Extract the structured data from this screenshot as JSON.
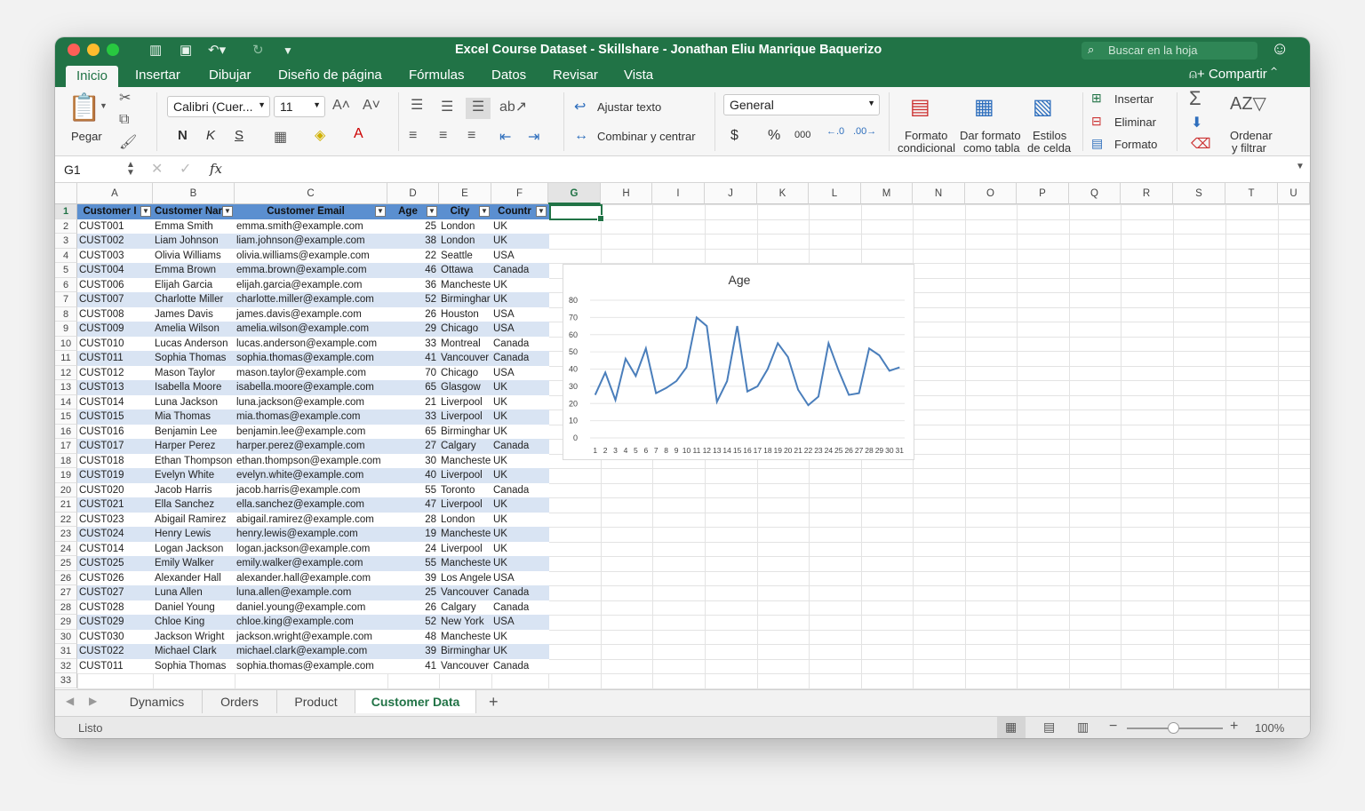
{
  "window": {
    "title": "Excel Course Dataset - Skillshare - Jonathan Eliu Manrique Baquerizo",
    "search_placeholder": "Buscar en la hoja"
  },
  "ribbon_tabs": [
    "Inicio",
    "Insertar",
    "Dibujar",
    "Diseño de página",
    "Fórmulas",
    "Datos",
    "Revisar",
    "Vista"
  ],
  "share_label": "Compartir",
  "ribbon": {
    "paste": "Pegar",
    "font": "Calibri (Cuer...",
    "font_size": "11",
    "bold": "N",
    "italic": "K",
    "underline": "S",
    "wrap_text": "Ajustar texto",
    "merge_center": "Combinar y centrar",
    "number_format": "General",
    "currency": "$",
    "percent": "%",
    "thousands": "000",
    "cond_format_1": "Formato",
    "cond_format_2": "condicional",
    "table_format_1": "Dar formato",
    "table_format_2": "como tabla",
    "cell_styles_1": "Estilos",
    "cell_styles_2": "de celda",
    "insert": "Insertar",
    "delete": "Eliminar",
    "format": "Formato",
    "sort_filter_1": "Ordenar",
    "sort_filter_2": "y filtrar"
  },
  "formula_bar": {
    "name_box": "G1",
    "fx": "fx",
    "value": ""
  },
  "columns": [
    "A",
    "B",
    "C",
    "D",
    "E",
    "F",
    "G",
    "H",
    "I",
    "J",
    "K",
    "L",
    "M",
    "N",
    "O",
    "P",
    "Q",
    "R",
    "S",
    "T",
    "U"
  ],
  "header_row": [
    "Customer I",
    "Customer Nan",
    "Customer Email",
    "Age",
    "City",
    "Countr"
  ],
  "rows": [
    [
      "CUST001",
      "Emma Smith",
      "emma.smith@example.com",
      "25",
      "London",
      "UK"
    ],
    [
      "CUST002",
      "Liam Johnson",
      "liam.johnson@example.com",
      "38",
      "London",
      "UK"
    ],
    [
      "CUST003",
      "Olivia Williams",
      "olivia.williams@example.com",
      "22",
      "Seattle",
      "USA"
    ],
    [
      "CUST004",
      "Emma Brown",
      "emma.brown@example.com",
      "46",
      "Ottawa",
      "Canada"
    ],
    [
      "CUST006",
      "Elijah Garcia",
      "elijah.garcia@example.com",
      "36",
      "Mancheste",
      "UK"
    ],
    [
      "CUST007",
      "Charlotte Miller",
      "charlotte.miller@example.com",
      "52",
      "Birminghar",
      "UK"
    ],
    [
      "CUST008",
      "James Davis",
      "james.davis@example.com",
      "26",
      "Houston",
      "USA"
    ],
    [
      "CUST009",
      "Amelia Wilson",
      "amelia.wilson@example.com",
      "29",
      "Chicago",
      "USA"
    ],
    [
      "CUST010",
      "Lucas Anderson",
      "lucas.anderson@example.com",
      "33",
      "Montreal",
      "Canada"
    ],
    [
      "CUST011",
      "Sophia Thomas",
      "sophia.thomas@example.com",
      "41",
      "Vancouver",
      "Canada"
    ],
    [
      "CUST012",
      "Mason Taylor",
      "mason.taylor@example.com",
      "70",
      "Chicago",
      "USA"
    ],
    [
      "CUST013",
      "Isabella Moore",
      "isabella.moore@example.com",
      "65",
      "Glasgow",
      "UK"
    ],
    [
      "CUST014",
      "Luna Jackson",
      "luna.jackson@example.com",
      "21",
      "Liverpool",
      "UK"
    ],
    [
      "CUST015",
      "Mia Thomas",
      "mia.thomas@example.com",
      "33",
      "Liverpool",
      "UK"
    ],
    [
      "CUST016",
      "Benjamin Lee",
      "benjamin.lee@example.com",
      "65",
      "Birminghar",
      "UK"
    ],
    [
      "CUST017",
      "Harper Perez",
      "harper.perez@example.com",
      "27",
      "Calgary",
      "Canada"
    ],
    [
      "CUST018",
      "Ethan Thompson",
      "ethan.thompson@example.com",
      "30",
      "Mancheste",
      "UK"
    ],
    [
      "CUST019",
      "Evelyn White",
      "evelyn.white@example.com",
      "40",
      "Liverpool",
      "UK"
    ],
    [
      "CUST020",
      "Jacob Harris",
      "jacob.harris@example.com",
      "55",
      "Toronto",
      "Canada"
    ],
    [
      "CUST021",
      "Ella Sanchez",
      "ella.sanchez@example.com",
      "47",
      "Liverpool",
      "UK"
    ],
    [
      "CUST023",
      "Abigail Ramirez",
      "abigail.ramirez@example.com",
      "28",
      "London",
      "UK"
    ],
    [
      "CUST024",
      "Henry Lewis",
      "henry.lewis@example.com",
      "19",
      "Mancheste",
      "UK"
    ],
    [
      "CUST014",
      "Logan Jackson",
      "logan.jackson@example.com",
      "24",
      "Liverpool",
      "UK"
    ],
    [
      "CUST025",
      "Emily Walker",
      "emily.walker@example.com",
      "55",
      "Mancheste",
      "UK"
    ],
    [
      "CUST026",
      "Alexander Hall",
      "alexander.hall@example.com",
      "39",
      "Los Angeles",
      "USA"
    ],
    [
      "CUST027",
      "Luna Allen",
      "luna.allen@example.com",
      "25",
      "Vancouver",
      "Canada"
    ],
    [
      "CUST028",
      "Daniel Young",
      "daniel.young@example.com",
      "26",
      "Calgary",
      "Canada"
    ],
    [
      "CUST029",
      "Chloe King",
      "chloe.king@example.com",
      "52",
      "New York",
      "USA"
    ],
    [
      "CUST030",
      "Jackson Wright",
      "jackson.wright@example.com",
      "48",
      "Mancheste",
      "UK"
    ],
    [
      "CUST022",
      "Michael Clark",
      "michael.clark@example.com",
      "39",
      "Birminghar",
      "UK"
    ],
    [
      "CUST011",
      "Sophia Thomas",
      "sophia.thomas@example.com",
      "41",
      "Vancouver",
      "Canada"
    ]
  ],
  "chart_data": {
    "type": "line",
    "title": "Age",
    "x": [
      1,
      2,
      3,
      4,
      5,
      6,
      7,
      8,
      9,
      10,
      11,
      12,
      13,
      14,
      15,
      16,
      17,
      18,
      19,
      20,
      21,
      22,
      23,
      24,
      25,
      26,
      27,
      28,
      29,
      30,
      31
    ],
    "series": [
      {
        "values": [
          25,
          38,
          22,
          46,
          36,
          52,
          26,
          29,
          33,
          41,
          70,
          65,
          21,
          33,
          65,
          27,
          30,
          40,
          55,
          47,
          28,
          19,
          24,
          55,
          39,
          25,
          26,
          52,
          48,
          39,
          41
        ]
      }
    ],
    "ylim": [
      0,
      80
    ],
    "yticks": [
      0,
      10,
      20,
      30,
      40,
      50,
      60,
      70,
      80
    ],
    "grid": true,
    "line_color": "#4a7ebb"
  },
  "sheets": [
    "Dynamics",
    "Orders",
    "Product",
    "Customer Data"
  ],
  "active_sheet": "Customer Data",
  "status": {
    "ready": "Listo",
    "zoom": "100%"
  },
  "colors": {
    "brand": "#217346",
    "table_header": "#5b8fd0",
    "band": "#d9e4f3"
  }
}
